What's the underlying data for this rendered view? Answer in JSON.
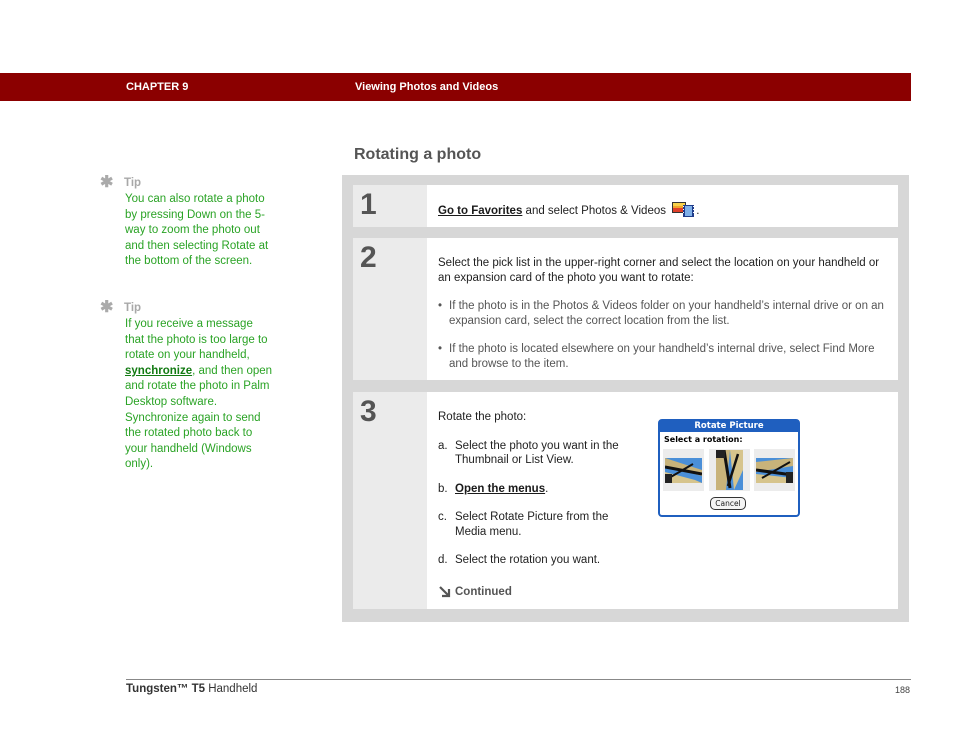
{
  "header": {
    "chapter": "CHAPTER 9",
    "title": "Viewing Photos and Videos",
    "band_color": "#8b0000"
  },
  "sidebar": {
    "tips": [
      {
        "icon": "asterisk-icon",
        "label": "Tip",
        "text": "You can also rotate a photo by pressing Down on the 5-way to zoom the photo out and then selecting Rotate at the bottom of the screen."
      },
      {
        "icon": "asterisk-icon",
        "label": "Tip",
        "text_before": "If you receive a message that the photo is too large to rotate on your handheld, ",
        "link": "synchronize",
        "text_after": ", and then open and rotate the photo in Palm Desktop software. Synchronize again to send the rotated photo back to your handheld (Windows only)."
      }
    ],
    "text_color": "#2aa325"
  },
  "main": {
    "section_title": "Rotating a photo",
    "steps": [
      {
        "number": "1",
        "link": "Go to Favorites",
        "text": " and select Photos & Videos",
        "icon": "photos-videos-icon",
        "text_end": "."
      },
      {
        "number": "2",
        "intro": "Select the pick list in the upper-right corner and select the location on your handheld or an expansion card of the photo you want to rotate:",
        "bullets": [
          "If the photo is in the Photos & Videos folder on your handheld’s internal drive or on an expansion card, select the correct location from the list.",
          "If the photo is located elsewhere on your handheld’s internal drive, select Find More and browse to the item."
        ]
      },
      {
        "number": "3",
        "intro": "Rotate the photo:",
        "substeps": [
          {
            "letter": "a.",
            "text": "Select the photo you want in the Thumbnail or List View."
          },
          {
            "letter": "b.",
            "link": "Open the menus",
            "text": "."
          },
          {
            "letter": "c.",
            "text": "Select Rotate Picture from the Media menu."
          },
          {
            "letter": "d.",
            "text": "Select the rotation you want."
          }
        ],
        "continued": "Continued",
        "dialog": {
          "title": "Rotate Picture",
          "prompt": "Select a rotation:",
          "options": [
            "rotate-left",
            "rotate-180",
            "rotate-right"
          ],
          "cancel_label": "Cancel",
          "accent": "#1f5fbf"
        }
      }
    ]
  },
  "footer": {
    "product_bold": "Tungsten™ T5",
    "product_rest": " Handheld",
    "page_number": "188"
  }
}
